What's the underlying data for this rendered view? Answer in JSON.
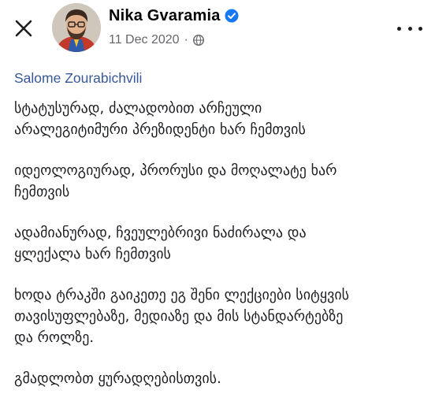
{
  "post": {
    "author_name": "Nika Gvaramia",
    "date": "11 Dec 2020",
    "separator": "·",
    "mention": "Salome Zourabichvili",
    "paragraphs": [
      "სტატუსურად, ძალადობით არჩეული\nარალეგიტიმური პრეზიდენტი ხარ ჩემთვის",
      "იდეოლოგიურად, პრორუსი და მოღალატე ხარ\nჩემთვის",
      "ადამიანურად, ჩვეულებრივი ნაძირალა და\nყლექალა ხარ ჩემთვის",
      "ხოდა ტრაკში გაიკეთე ეგ შენი ლექციები სიტყვის\nთავისუფლებაზე, მედიაზე და მის სტანდარტებზე\nდა როლზე.",
      "გმადლობთ ყურადღებისთვის."
    ]
  },
  "icons": {
    "close": "close-icon",
    "verified": "verified-badge-icon",
    "audience": "globe-icon",
    "more": "more-options-icon"
  },
  "colors": {
    "mention_link": "#385898",
    "verified_badge": "#1877f2",
    "meta_text": "#65676b"
  }
}
